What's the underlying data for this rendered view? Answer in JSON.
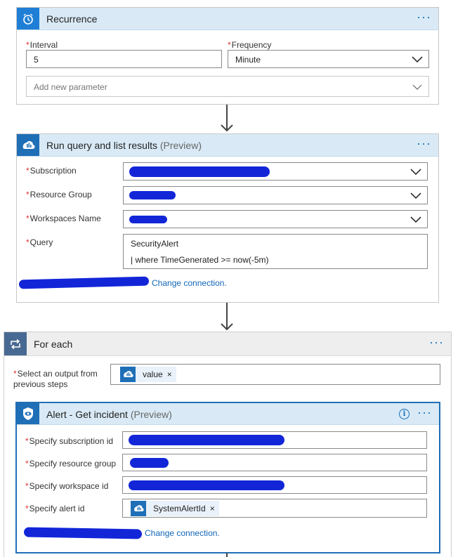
{
  "recurrence": {
    "title": "Recurrence",
    "menu": "···",
    "interval_label": "Interval",
    "interval_value": "5",
    "frequency_label": "Frequency",
    "frequency_value": "Minute",
    "add_param_placeholder": "Add new parameter"
  },
  "run_query": {
    "title": "Run query and list results",
    "title_suffix": "(Preview)",
    "menu": "···",
    "subscription_label": "Subscription",
    "resource_group_label": "Resource Group",
    "workspaces_label": "Workspaces Name",
    "query_label": "Query",
    "query_line1": "SecurityAlert",
    "query_line2": "| where TimeGenerated >= now(-5m)",
    "change_connection": "Change connection."
  },
  "for_each": {
    "title": "For each",
    "menu": "···",
    "select_label_line1": "Select an output from",
    "select_label_line2": "previous steps",
    "token_value": "value",
    "token_remove": "×"
  },
  "alert": {
    "title": "Alert - Get incident",
    "title_suffix": "(Preview)",
    "menu": "···",
    "subscription_label": "Specify subscription id",
    "resource_group_label": "Specify resource group",
    "workspace_label": "Specify workspace id",
    "alert_id_label": "Specify alert id",
    "alert_token": "SystemAlertId",
    "token_remove": "×",
    "change_connection": "Change connection."
  },
  "required_marker": "*",
  "colors": {
    "header_bg": "#d9eaf6",
    "accent": "#1f6fb7",
    "link": "#1266b8",
    "required": "#d33333",
    "redaction": "#1226d8"
  },
  "icons": {
    "recurrence": "alarm-clock-icon",
    "run_query": "log-analytics-icon",
    "for_each": "loop-icon",
    "alert": "shield-eye-icon",
    "info": "info-icon",
    "chevron": "chevron-down-icon"
  }
}
